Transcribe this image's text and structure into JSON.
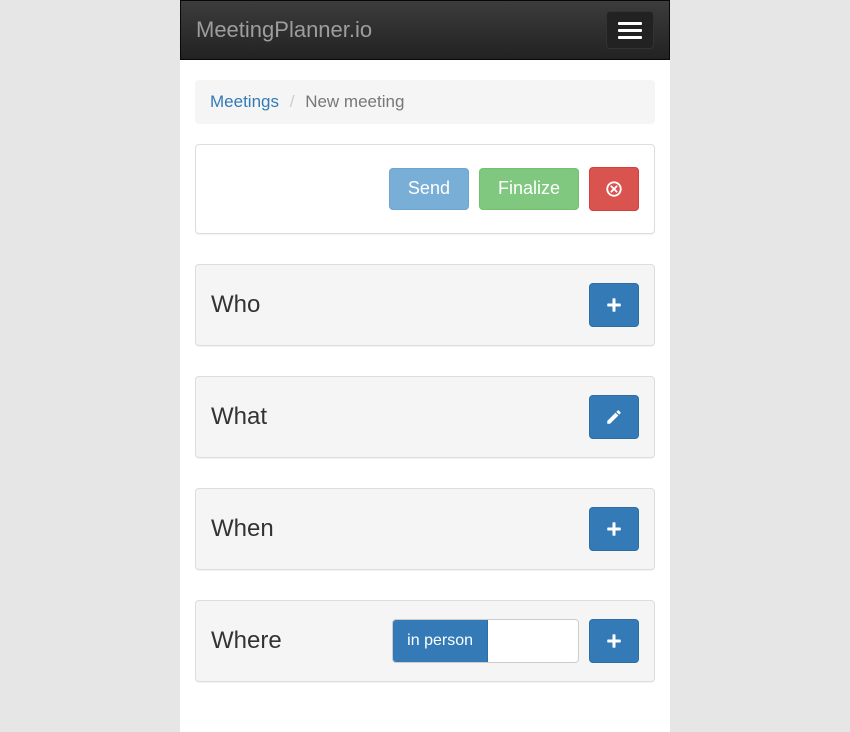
{
  "navbar": {
    "brand": "MeetingPlanner.io"
  },
  "breadcrumb": {
    "root": "Meetings",
    "current": "New meeting"
  },
  "actions": {
    "send": "Send",
    "finalize": "Finalize"
  },
  "sections": {
    "who": {
      "title": "Who"
    },
    "what": {
      "title": "What"
    },
    "when": {
      "title": "When"
    },
    "where": {
      "title": "Where",
      "mode_label": "in person",
      "mode_value": ""
    }
  }
}
